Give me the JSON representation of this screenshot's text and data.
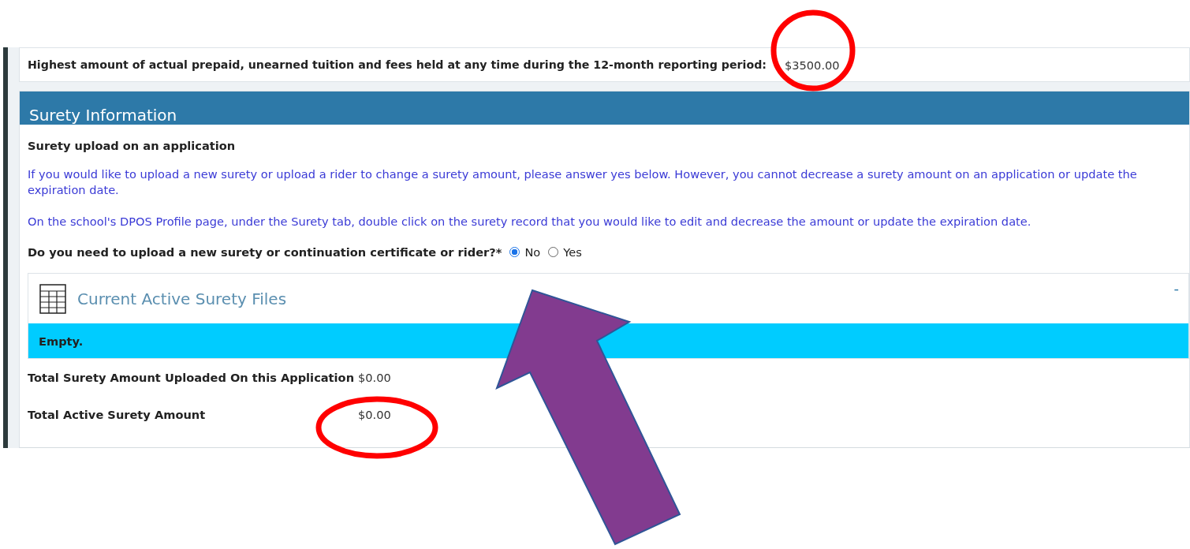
{
  "tuition": {
    "label": "Highest amount of actual prepaid, unearned tuition and fees held at any time during the 12-month reporting period:",
    "value": "$3500.00"
  },
  "section": {
    "title": "Surety Information",
    "subtitle": "Surety upload on an application",
    "notes": [
      "If you would like to upload a new surety or upload a rider to change a surety amount, please answer yes below. However, you cannot decrease a surety amount on an application or update the expiration date.",
      "On the school's DPOS Profile page, under the Surety tab, double click on the surety record that you would like to edit and decrease the amount or update the expiration date."
    ],
    "question": {
      "label": "Do you need to upload a new surety or continuation certificate or rider?*",
      "options": [
        {
          "label": "No",
          "selected": true
        },
        {
          "label": "Yes",
          "selected": false
        }
      ]
    },
    "files_panel": {
      "title": "Current Active Surety Files",
      "collapse": "-",
      "empty_text": "Empty."
    },
    "totals": [
      {
        "label": "Total Surety Amount Uploaded On this Application",
        "value": "$0.00"
      },
      {
        "label": "Total Active Surety Amount",
        "value": "$0.00"
      }
    ]
  },
  "annotations": [
    {
      "kind": "ellipse"
    },
    {
      "kind": "ellipse"
    },
    {
      "kind": "arrow"
    }
  ]
}
